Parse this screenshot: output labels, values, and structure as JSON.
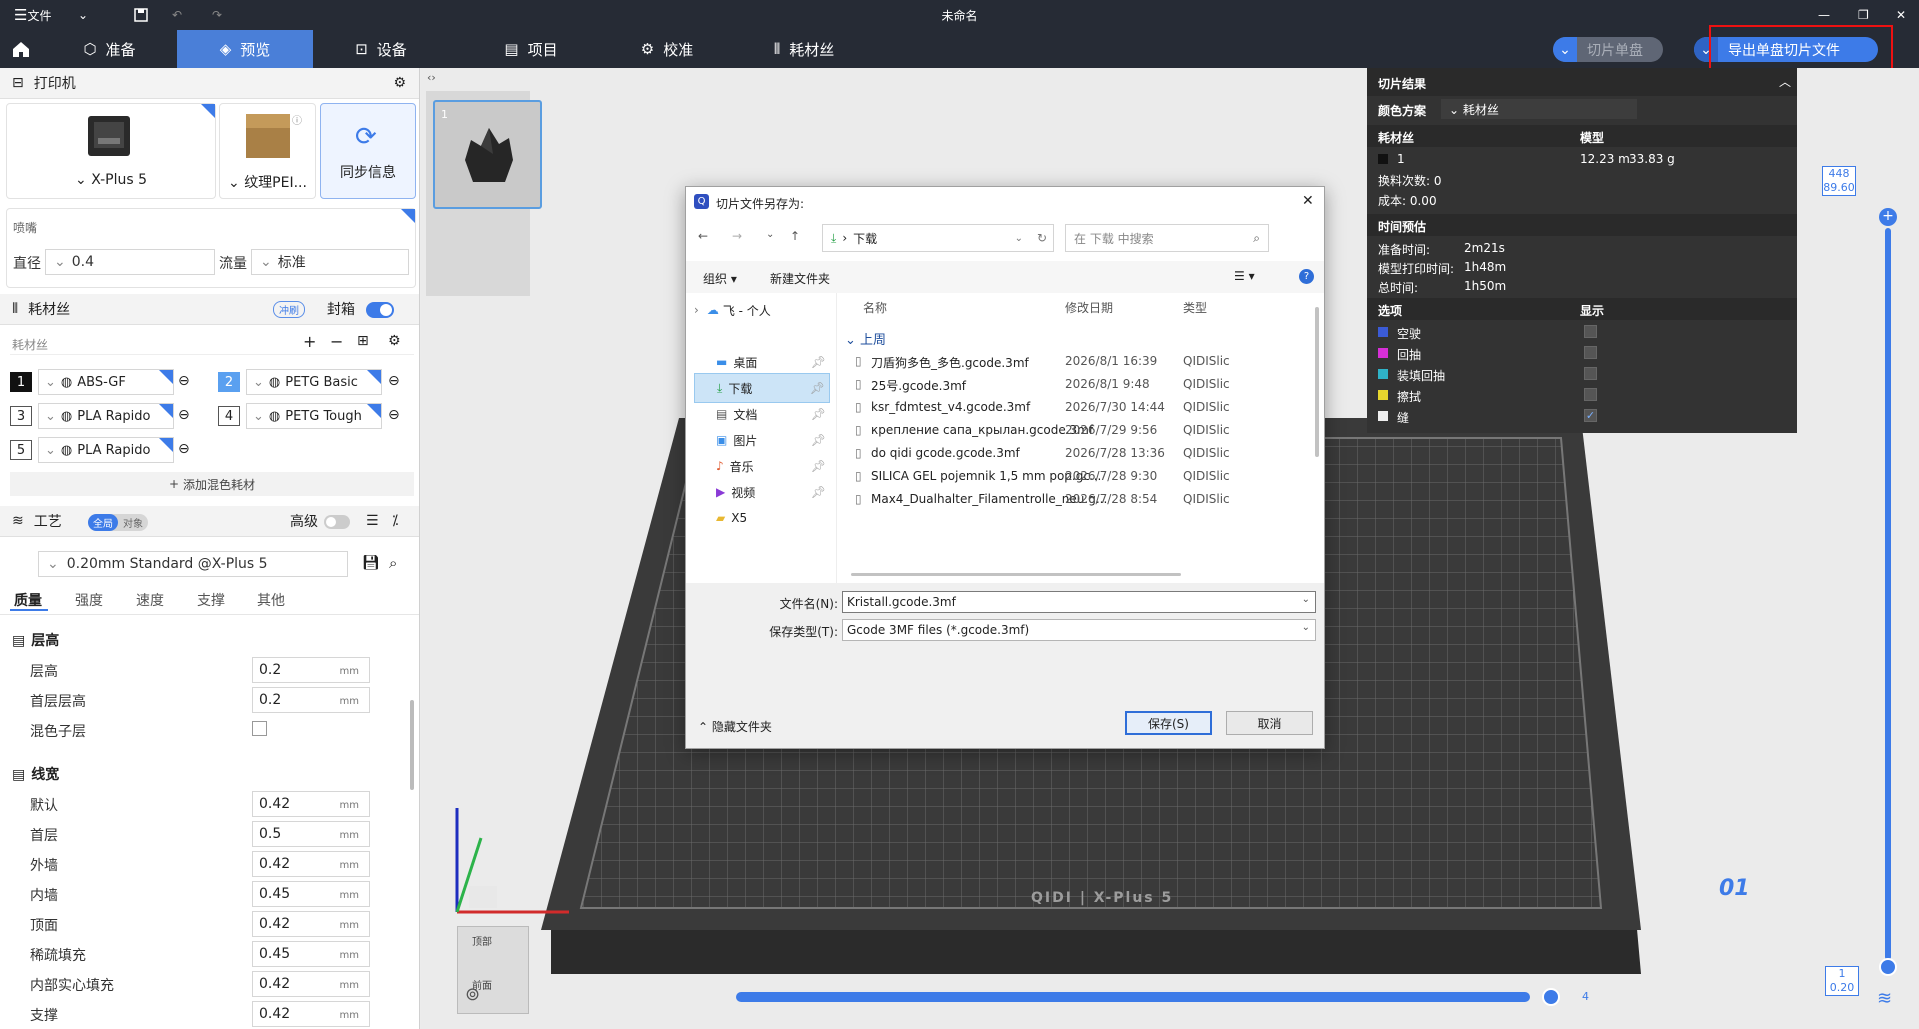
{
  "window": {
    "title": "未命名",
    "menu": "文件"
  },
  "nav": {
    "tabs": [
      "准备",
      "预览",
      "设备",
      "项目",
      "校准",
      "耗材丝"
    ],
    "slice_plate": "切片单盘",
    "export_plate": "导出单盘切片文件"
  },
  "printer": {
    "title": "打印机",
    "model": "X-Plus 5",
    "plate": "纹理PEI...",
    "sync": "同步信息",
    "nozzle_title": "喷嘴",
    "diameter_label": "直径",
    "diameter": "0.4",
    "flow_label": "流量",
    "flow": "标准"
  },
  "filament": {
    "title": "耗材丝",
    "flush": "冲刷",
    "seal": "封箱",
    "sub": "耗材丝",
    "add_mixed": "添加混色耗材",
    "items": [
      {
        "n": "1",
        "name": "ABS-GF"
      },
      {
        "n": "2",
        "name": "PETG Basic"
      },
      {
        "n": "3",
        "name": "PLA Rapido"
      },
      {
        "n": "4",
        "name": "PETG Tough"
      },
      {
        "n": "5",
        "name": "PLA Rapido"
      }
    ]
  },
  "process": {
    "title": "工艺",
    "global": "全局",
    "object": "对象",
    "advanced": "高级",
    "preset": "0.20mm Standard @X-Plus 5",
    "subtabs": [
      "质量",
      "强度",
      "速度",
      "支撑",
      "其他"
    ],
    "layer_group": "层高",
    "rows1": [
      {
        "label": "层高",
        "value": "0.2"
      },
      {
        "label": "首层层高",
        "value": "0.2"
      }
    ],
    "mixed_label": "混色子层",
    "width_group": "线宽",
    "rows2": [
      {
        "label": "默认",
        "value": "0.42"
      },
      {
        "label": "首层",
        "value": "0.5"
      },
      {
        "label": "外墙",
        "value": "0.42"
      },
      {
        "label": "内墙",
        "value": "0.45"
      },
      {
        "label": "顶面",
        "value": "0.42"
      },
      {
        "label": "稀疏填充",
        "value": "0.45"
      },
      {
        "label": "内部实心填充",
        "value": "0.42"
      },
      {
        "label": "支撑",
        "value": "0.42"
      }
    ],
    "unit": "mm"
  },
  "thumb": {
    "index": "1"
  },
  "dialog": {
    "title": "切片文件另存为:",
    "path": "下载",
    "search_placeholder": "在 下载 中搜索",
    "organize": "组织",
    "new_folder": "新建文件夹",
    "nav": [
      "飞 - 个人",
      "桌面",
      "下载",
      "文档",
      "图片",
      "音乐",
      "视频",
      "X5"
    ],
    "columns": [
      "名称",
      "修改日期",
      "类型"
    ],
    "group": "上周",
    "files": [
      {
        "name": "刀盾狗多色_多色.gcode.3mf",
        "date": "2026/8/1 16:39",
        "type": "QIDISlic"
      },
      {
        "name": "25号.gcode.3mf",
        "date": "2026/8/1 9:48",
        "type": "QIDISlic"
      },
      {
        "name": "ksr_fdmtest_v4.gcode.3mf",
        "date": "2026/7/30 14:44",
        "type": "QIDISlic"
      },
      {
        "name": "крепление сапа_крылан.gcode.3mf",
        "date": "2026/7/29 9:56",
        "type": "QIDISlic"
      },
      {
        "name": "do qidi gcode.gcode.3mf",
        "date": "2026/7/28 13:36",
        "type": "QIDISlic"
      },
      {
        "name": "SILICA GEL pojemnik 1,5 mm pop.gc...",
        "date": "2026/7/28 9:30",
        "type": "QIDISlic"
      },
      {
        "name": "Max4_Dualhalter_Filamentrolle_neu.g...",
        "date": "2026/7/28 8:54",
        "type": "QIDISlic"
      }
    ],
    "filename_label": "文件名(N):",
    "filename": "Kristall.gcode.3mf",
    "type_label": "保存类型(T):",
    "filetype": "Gcode 3MF files (*.gcode.3mf)",
    "hide": "隐藏文件夹",
    "save": "保存(S)",
    "cancel": "取消"
  },
  "result": {
    "title": "切片结果",
    "color_scheme_label": "颜色方案",
    "color_scheme": "耗材丝",
    "filament_col": "耗材丝",
    "model_col": "模型",
    "fil_index": "1",
    "length": "12.23 m",
    "weight": "33.83 g",
    "changes": "换料次数:  0",
    "cost": "成本:  0.00",
    "time_title": "时间预估",
    "prep_label": "准备时间:",
    "prep": "2m21s",
    "model_time_label": "模型打印时间:",
    "model_time": "1h48m",
    "total_label": "总时间:",
    "total": "1h50m",
    "options_label": "选项",
    "display_label": "显示",
    "options": [
      {
        "name": "空驶",
        "color": "#3b5bd6"
      },
      {
        "name": "回抽",
        "color": "#d62fd6"
      },
      {
        "name": "装填回抽",
        "color": "#2fb3c8"
      },
      {
        "name": "擦拭",
        "color": "#e6d62e"
      },
      {
        "name": "缝",
        "color": "#eeeeee"
      }
    ]
  },
  "slider": {
    "top_a": "448",
    "top_b": "89.60",
    "bottom_a": "1",
    "bottom_b": "0.20",
    "h_value": "4"
  },
  "bed": {
    "brand": "QIDI | X-Plus 5",
    "plate": "01"
  },
  "viewcube": {
    "top": "顶部",
    "front": "前面"
  }
}
